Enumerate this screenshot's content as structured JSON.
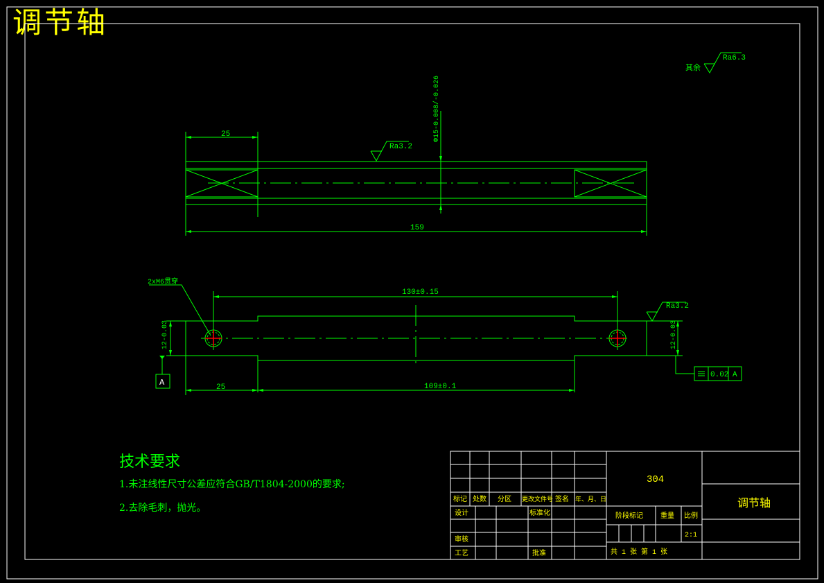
{
  "drawing": {
    "title": "调节轴",
    "surface_default_label": "其余",
    "surface_default_ra": "Ra6.3",
    "top_view": {
      "dim_left": "25",
      "dim_overall": "159",
      "dim_diameter": "Φ15-0.008/-0.026",
      "roughness": "Ra3.2"
    },
    "front_view": {
      "hole_note": "2xM6贯穿",
      "dim_hole_spacing": "130±0.15",
      "dim_left": "25",
      "dim_middle": "109±0.1",
      "dim_height_left": "12-0.03",
      "dim_height_right": "12-0.03",
      "roughness": "Ra3.2",
      "datum": "A",
      "tolerance_value": "0.02",
      "tolerance_datum": "A"
    },
    "tech_requirements": {
      "title": "技术要求",
      "items": [
        "1.未注线性尺寸公差应符合GB/T1804-2000的要求;",
        "2.去除毛刺，抛光。"
      ]
    },
    "title_block": {
      "material": "304",
      "part_name": "调节轴",
      "rev_headers": [
        "标记",
        "处数",
        "分区",
        "更改文件号",
        "签名",
        "年、月、日"
      ],
      "design_label": "设计",
      "standardize_label": "标准化",
      "review_label": "审核",
      "process_label": "工艺",
      "approve_label": "批准",
      "stage_label": "阶段标记",
      "weight_label": "重量",
      "scale_label": "比例",
      "scale_value": "2:1",
      "sheet_info": "共  1  张      第  1  张"
    }
  },
  "colors": {
    "background": "#000000",
    "lines": "#00ff00",
    "frame": "#ffffff",
    "title": "#ffff00",
    "marks": "#ff0000"
  }
}
